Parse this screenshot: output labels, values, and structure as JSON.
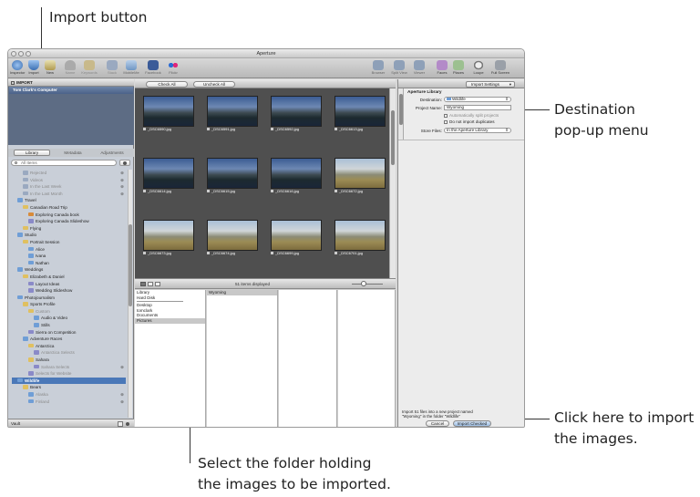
{
  "callouts": {
    "import_button": "Import button",
    "destination_menu_1": "Destination",
    "destination_menu_2": "pop-up menu",
    "import_images_1": "Click here to import",
    "import_images_2": "the images.",
    "select_folder_1": "Select the folder holding",
    "select_folder_2": "the images to be imported."
  },
  "window": {
    "title": "Aperture"
  },
  "toolbar": {
    "items": [
      "Inspector",
      "Import",
      "New",
      "Name",
      "Keywords",
      "Stack",
      "MobileMe",
      "Facebook",
      "Flickr",
      "Browser",
      "Split View",
      "Viewer",
      "Faces",
      "Places",
      "Loupe",
      "Full Screen"
    ]
  },
  "left": {
    "import_header": "IMPORT",
    "source": "Tom Clark's Computer",
    "tabs": [
      "Library",
      "Metadata",
      "Adjustments"
    ],
    "search_placeholder": "All Items",
    "tree": [
      "Rejected",
      "Videos",
      "In the Last Week",
      "In the Last Month",
      "Travel",
      "Canadian Road Trip",
      "Exploring Canada book",
      "Exploring Canada Slideshow",
      "Flying",
      "Studio",
      "Portrait Session",
      "Alice",
      "Ivana",
      "Nathan",
      "Weddings",
      "Elizabeth & Daniel",
      "Layout Ideas",
      "Wedding Slideshow",
      "Photojournalism",
      "Sports Profile",
      "Custom",
      "Audio & Video",
      "Stills",
      "Sierra on Competition",
      "Adventure Races",
      "Antarctica",
      "Antarctica Selects",
      "Sahara",
      "Sahara Selects",
      "Selects for Website",
      "Wildlife",
      "Bears",
      "Alaska",
      "Finland"
    ],
    "footer": "Vault"
  },
  "center": {
    "check_all": "Check All",
    "uncheck_all": "Uncheck All",
    "thumbnails": [
      "_DSC6590.jpg",
      "_DSC6591.jpg",
      "_DSC6592.jpg",
      "_DSC6613.jpg",
      "_DSC6614.jpg",
      "_DSC6615.jpg",
      "_DSC6616.jpg",
      "_DSC6672.jpg",
      "_DSC6673.jpg",
      "_DSC6674.jpg",
      "_DSC6699.jpg",
      "_DSC6701.jpg"
    ],
    "status": "51 items displayed",
    "browser_col1": [
      "Library",
      "Hard Disk",
      "",
      "Desktop",
      "tomclark",
      "Documents",
      "Pictures"
    ],
    "browser_col2": [
      "Wyoming"
    ]
  },
  "right": {
    "import_settings": "Import Settings",
    "section": "Aperture Library",
    "destination_label": "Destination:",
    "destination_value": "Wildlife",
    "project_label": "Project Name:",
    "project_value": "Wyoming",
    "auto_split": "Automatically split projects",
    "no_duplicates": "Do not import duplicates",
    "store_label": "Store Files:",
    "store_value": "In the Aperture Library",
    "summary": "Import 51 files into a new project named \"Wyoming\" in the folder \"Wildlife\"",
    "cancel": "Cancel",
    "import_checked": "Import Checked"
  }
}
